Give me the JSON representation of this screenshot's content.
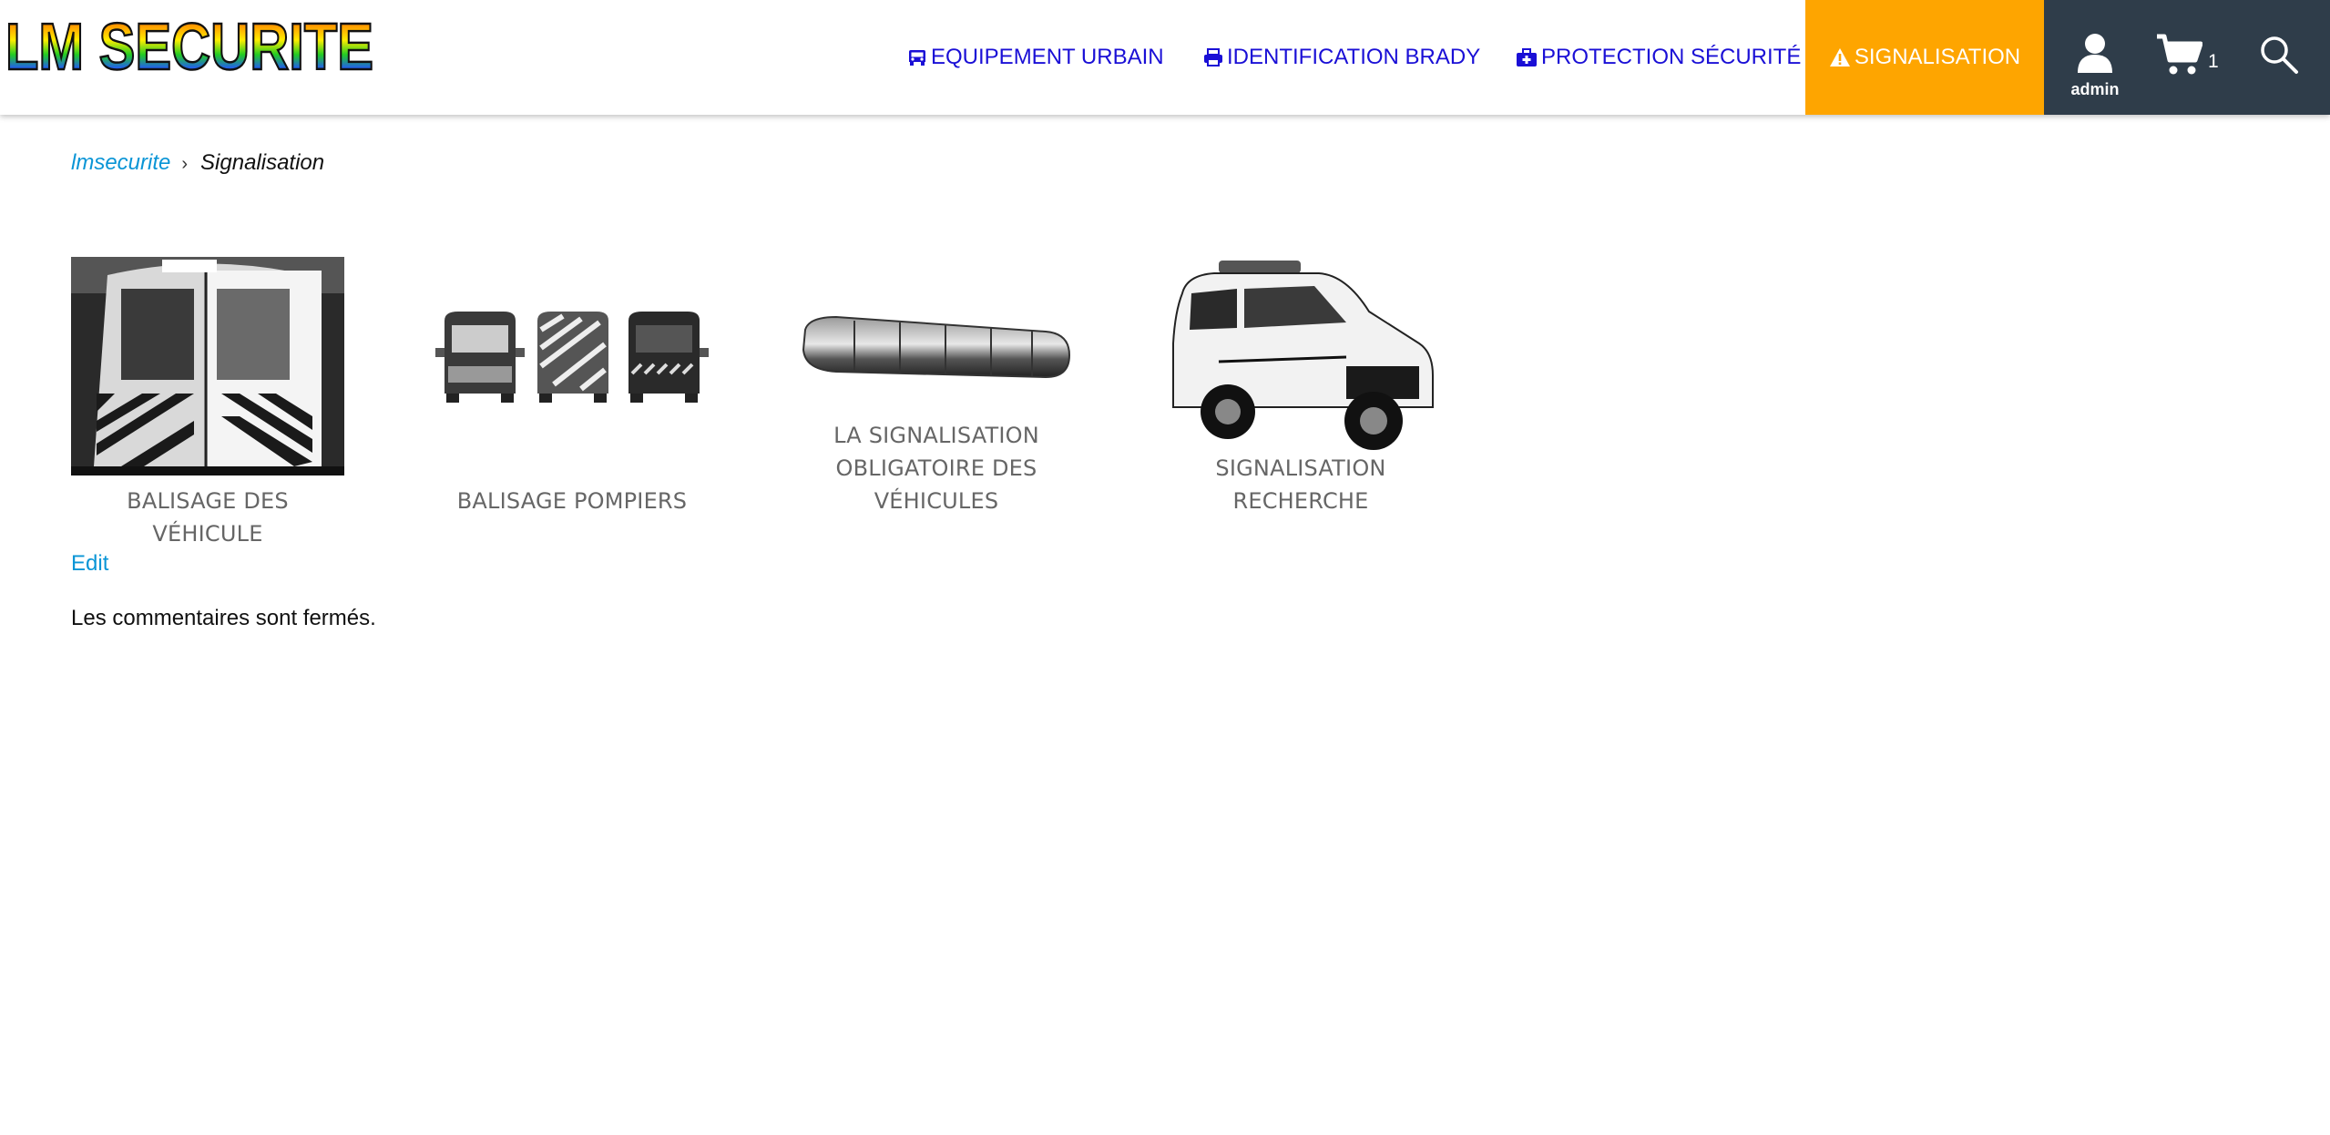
{
  "header": {
    "logo_text": "LM SECURITE",
    "nav": [
      {
        "label": "EQUIPEMENT URBAIN",
        "icon": "car-icon"
      },
      {
        "label": "IDENTIFICATION BRADY",
        "icon": "printer-icon"
      },
      {
        "label": "PROTECTION SÉCURITÉ",
        "icon": "medkit-icon"
      },
      {
        "label": "SIGNALISATION",
        "icon": "warning-icon"
      }
    ],
    "user_label": "admin",
    "cart_count": "1"
  },
  "breadcrumb": {
    "home": "lmsecurite",
    "separator": "›",
    "current": "Signalisation"
  },
  "categories": [
    {
      "title": "BALISAGE DES VÉHICULE"
    },
    {
      "title": "BALISAGE POMPIERS"
    },
    {
      "title": "LA SIGNALISATION OBLIGATOIRE DES VÉHICULES"
    },
    {
      "title": "SIGNALISATION RECHERCHE"
    }
  ],
  "edit_label": "Edit",
  "comments_text": "Les commentaires sont fermés.",
  "colors": {
    "accent": "#fea500",
    "dark": "#2f3d4a",
    "link": "#0a95d6",
    "nav": "#1a0fd6"
  }
}
